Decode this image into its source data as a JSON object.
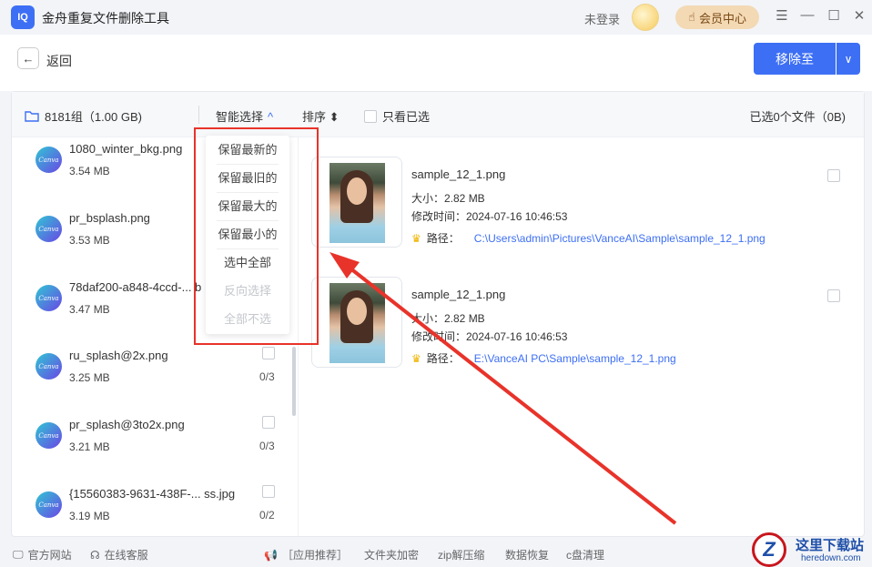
{
  "app": {
    "logo_text": "IQ",
    "title": "金舟重复文件删除工具",
    "login_status": "未登录",
    "member_center": "会员中心"
  },
  "window": {
    "menu_icon": "hamburger-icon",
    "min_icon": "minimize-icon",
    "max_icon": "maximize-icon",
    "close_icon": "close-icon"
  },
  "toolbar": {
    "back_label": "返回",
    "move_to_label": "移除至"
  },
  "panel_head": {
    "group_label": "8181组（1.00 GB)",
    "smart_select": "智能选择",
    "sort": "排序",
    "only_selected": "只看已选",
    "selected_count": "已选0个文件（0B)"
  },
  "smart_menu": {
    "items": [
      {
        "label": "保留最新的",
        "disabled": false
      },
      {
        "label": "保留最旧的",
        "disabled": false
      },
      {
        "label": "保留最大的",
        "disabled": false
      },
      {
        "label": "保留最小的",
        "disabled": false
      },
      {
        "label": "选中全部",
        "disabled": false
      },
      {
        "label": "反向选择",
        "disabled": true
      },
      {
        "label": "全部不选",
        "disabled": true
      }
    ]
  },
  "file_groups": [
    {
      "name": "1080_winter_bkg.png",
      "size": "3.54 MB",
      "count": ""
    },
    {
      "name": "pr_bsplash.png",
      "size": "3.53 MB",
      "count": ""
    },
    {
      "name": "78daf200-a848-4ccd-... b",
      "size": "3.47 MB",
      "count": ""
    },
    {
      "name": "ru_splash@2x.png",
      "size": "3.25 MB",
      "count": "0/3"
    },
    {
      "name": "pr_splash@3to2x.png",
      "size": "3.21 MB",
      "count": "0/3"
    },
    {
      "name": "{15560383-9631-438F-... ss.jpg",
      "size": "3.19 MB",
      "count": "0/2"
    }
  ],
  "file_icon_text": "Canva",
  "duplicates": [
    {
      "name": "sample_12_1.png",
      "size": "大小：2.82 MB",
      "mtime": "修改时间：2024-07-16 10:46:53",
      "path_label": "路径：",
      "path": "C:\\Users\\admin\\Pictures\\VanceAI\\Sample\\sample_12_1.png"
    },
    {
      "name": "sample_12_1.png",
      "size": "大小：2.82 MB",
      "mtime": "修改时间：2024-07-16 10:46:53",
      "path_label": "路径：",
      "path": "E:\\VanceAI PC\\Sample\\sample_12_1.png"
    }
  ],
  "footer": {
    "official_site": "官方网站",
    "online_service": "在线客服",
    "recommend": "［应用推荐］",
    "folder_encrypt": "文件夹加密",
    "zip": "zip解压缩",
    "data_recovery": "数据恢复",
    "c_clean": "c盘清理"
  },
  "watermark": {
    "logo": "Z",
    "title": "这里下载站",
    "subtitle": "heredown.com"
  },
  "colors": {
    "accent": "#3d6ff5",
    "highlight": "#e8332a"
  }
}
